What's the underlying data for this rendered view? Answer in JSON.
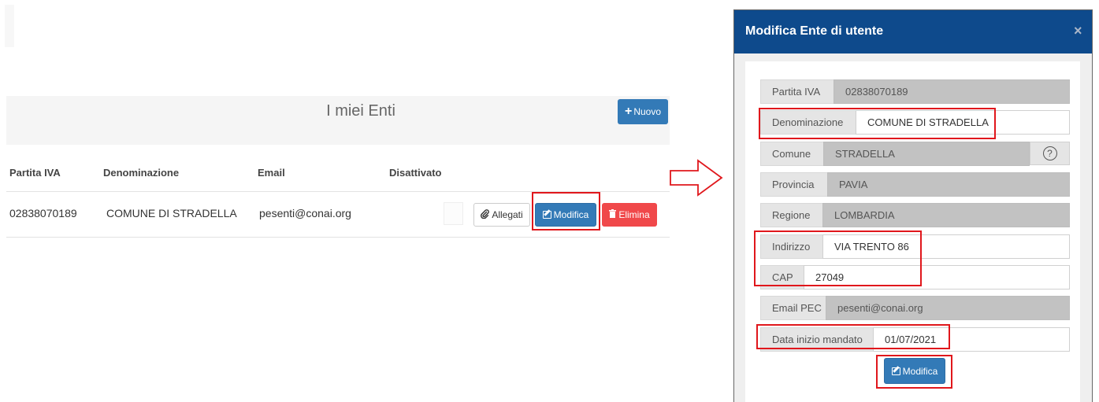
{
  "list_page": {
    "title": "I miei Enti",
    "new_button": "Nuovo",
    "columns": [
      "Partita IVA",
      "Denominazione",
      "Email",
      "Disattivato"
    ],
    "rows": [
      {
        "partita_iva": "02838070189",
        "denominazione": "COMUNE DI STRADELLA",
        "email": "pesenti@conai.org",
        "disattivato": false
      }
    ],
    "actions": {
      "allegati": "Allegati",
      "modifica": "Modifica",
      "elimina": "Elimina"
    }
  },
  "modal": {
    "title": "Modifica Ente di utente",
    "close_glyph": "×",
    "fields": {
      "partita_iva": {
        "label": "Partita IVA",
        "value": "02838070189"
      },
      "denominazione": {
        "label": "Denominazione",
        "value": "COMUNE DI STRADELLA"
      },
      "comune": {
        "label": "Comune",
        "value": "STRADELLA"
      },
      "provincia": {
        "label": "Provincia",
        "value": "PAVIA"
      },
      "regione": {
        "label": "Regione",
        "value": "LOMBARDIA"
      },
      "indirizzo": {
        "label": "Indirizzo",
        "value": "VIA TRENTO 86"
      },
      "cap": {
        "label": "CAP",
        "value": "27049"
      },
      "email_pec": {
        "label": "Email PEC",
        "value": "pesenti@conai.org"
      },
      "data_inizio": {
        "label": "Data inizio mandato",
        "value": "01/07/2021"
      }
    },
    "help_glyph": "?",
    "submit_button": "Modifica"
  },
  "colors": {
    "primary": "#337ab7",
    "danger": "#f0484a",
    "modal_header": "#0e4a8c",
    "highlight": "#e0171c"
  },
  "icons": {
    "nuovo": "plus-icon",
    "allegati": "paperclip-icon",
    "modifica": "edit-icon",
    "elimina": "trash-icon",
    "close": "close-icon",
    "help": "question-icon",
    "arrow": "right-arrow-icon"
  }
}
